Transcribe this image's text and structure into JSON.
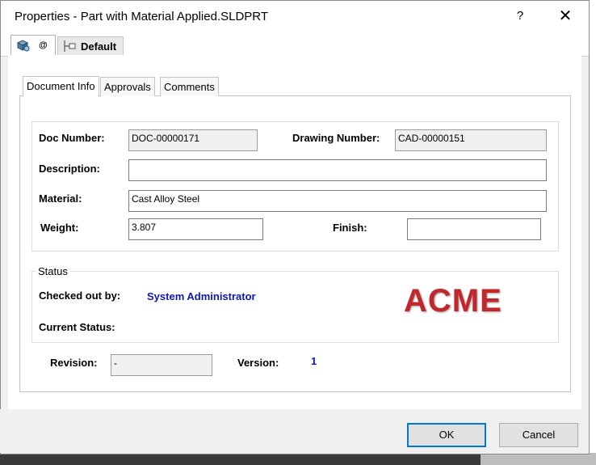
{
  "window": {
    "title": "Properties - Part with Material Applied.SLDPRT",
    "help": "?",
    "close": "✕"
  },
  "config_tabs": [
    {
      "label": "@"
    },
    {
      "label": "Default"
    }
  ],
  "tabs": [
    {
      "label": "Document Info",
      "active": true
    },
    {
      "label": "Approvals"
    },
    {
      "label": "Comments"
    }
  ],
  "fields": {
    "doc_number_label": "Doc Number:",
    "doc_number": "DOC-00000171",
    "drawing_number_label": "Drawing Number:",
    "drawing_number": "CAD-00000151",
    "description_label": "Description:",
    "description": "",
    "material_label": "Material:",
    "material": "Cast Alloy Steel",
    "weight_label": "Weight:",
    "weight": "3.807",
    "finish_label": "Finish:",
    "finish": ""
  },
  "status": {
    "legend": "Status",
    "checked_out_label": "Checked out by:",
    "checked_out_by": "System Administrator",
    "current_status_label": "Current Status:",
    "current_status": "",
    "logo": "ACME"
  },
  "revision": {
    "revision_label": "Revision:",
    "revision": "-",
    "version_label": "Version:",
    "version": "1"
  },
  "buttons": {
    "ok": "OK",
    "cancel": "Cancel"
  },
  "colors": {
    "accent": "#0078d7",
    "value_blue": "#0a17b8",
    "logo_red": "#c1272d"
  }
}
